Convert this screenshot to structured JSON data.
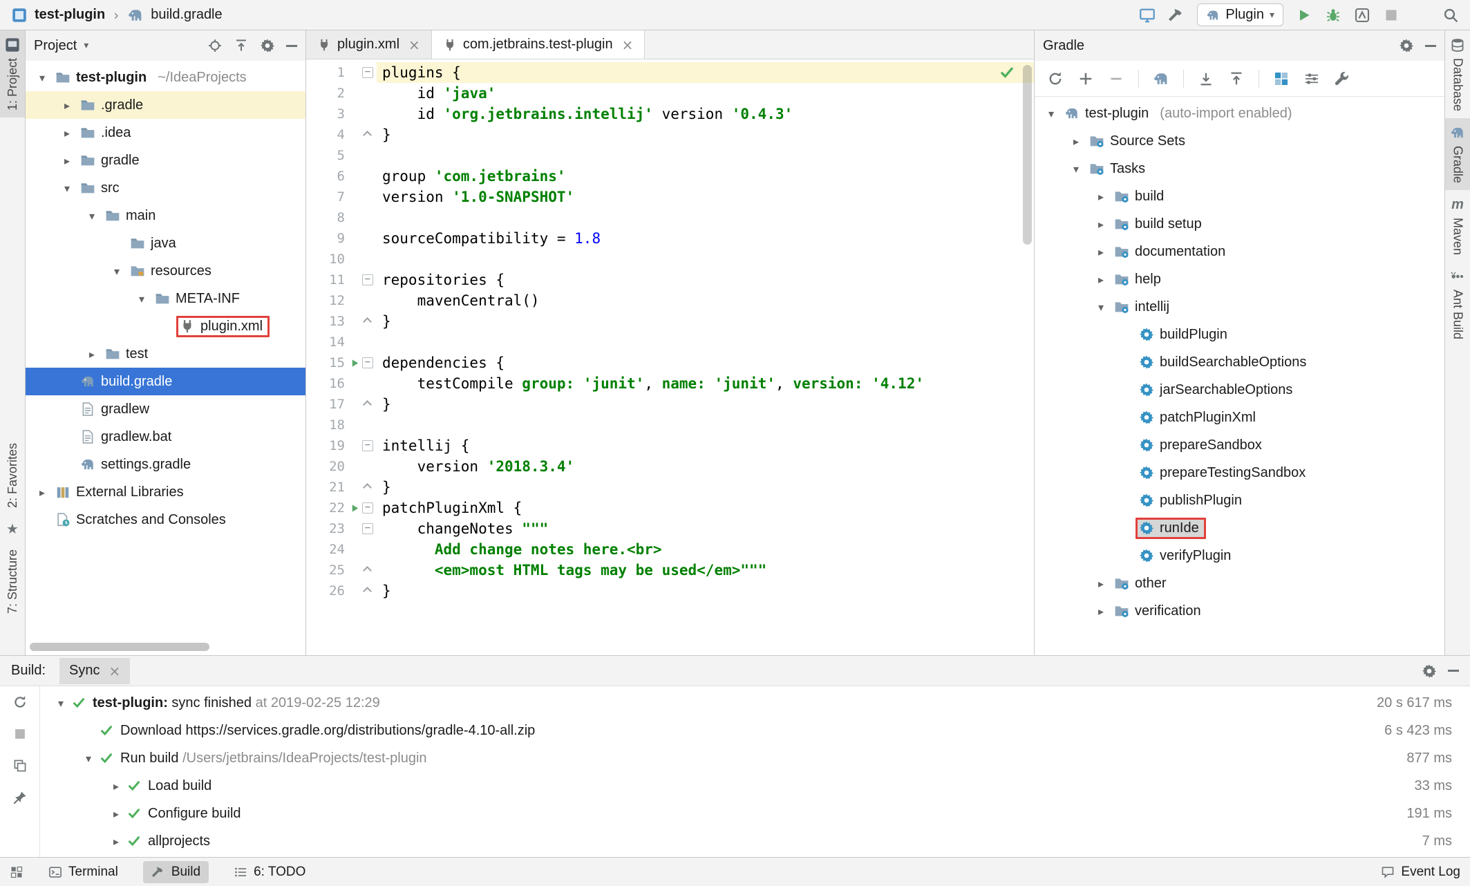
{
  "toolbar": {
    "project_name": "test-plugin",
    "separator": "›",
    "file_name": "build.gradle",
    "run_config": "Plugin"
  },
  "project_panel": {
    "title": "Project",
    "items": [
      {
        "label": "test-plugin",
        "hint": "~/IdeaProjects",
        "depth": 0,
        "arrow": "down",
        "icon": "folder",
        "bold": true
      },
      {
        "label": ".gradle",
        "depth": 1,
        "arrow": "right",
        "icon": "folder",
        "hl": true
      },
      {
        "label": ".idea",
        "depth": 1,
        "arrow": "right",
        "icon": "folder"
      },
      {
        "label": "gradle",
        "depth": 1,
        "arrow": "right",
        "icon": "folder"
      },
      {
        "label": "src",
        "depth": 1,
        "arrow": "down",
        "icon": "folder"
      },
      {
        "label": "main",
        "depth": 2,
        "arrow": "down",
        "icon": "folder"
      },
      {
        "label": "java",
        "depth": 3,
        "arrow": "none",
        "icon": "folder"
      },
      {
        "label": "resources",
        "depth": 3,
        "arrow": "down",
        "icon": "folder-res"
      },
      {
        "label": "META-INF",
        "depth": 4,
        "arrow": "down",
        "icon": "folder"
      },
      {
        "label": "plugin.xml",
        "depth": 5,
        "arrow": "none",
        "icon": "plug",
        "boxed": true
      },
      {
        "label": "test",
        "depth": 2,
        "arrow": "right",
        "icon": "folder"
      },
      {
        "label": "build.gradle",
        "depth": 1,
        "arrow": "none",
        "icon": "gradle",
        "selected": true
      },
      {
        "label": "gradlew",
        "depth": 1,
        "arrow": "none",
        "icon": "text-file"
      },
      {
        "label": "gradlew.bat",
        "depth": 1,
        "arrow": "none",
        "icon": "text-file"
      },
      {
        "label": "settings.gradle",
        "depth": 1,
        "arrow": "none",
        "icon": "gradle"
      },
      {
        "label": "External Libraries",
        "depth": 0,
        "arrow": "right",
        "icon": "libraries"
      },
      {
        "label": "Scratches and Consoles",
        "depth": 0,
        "arrow": "none",
        "icon": "scratches"
      }
    ]
  },
  "editor": {
    "tabs": [
      {
        "label": "plugin.xml",
        "active": false
      },
      {
        "label": "com.jetbrains.test-plugin",
        "active": true
      }
    ],
    "lines": [
      {
        "n": 1,
        "hl": true,
        "fold": "open",
        "seg": [
          [
            "plugins {",
            "d"
          ]
        ]
      },
      {
        "n": 2,
        "seg": [
          [
            "    id ",
            "d"
          ],
          [
            "'java'",
            "s"
          ]
        ]
      },
      {
        "n": 3,
        "seg": [
          [
            "    id ",
            "d"
          ],
          [
            "'org.jetbrains.intellij'",
            "s"
          ],
          [
            " version ",
            "d"
          ],
          [
            "'0.4.3'",
            "s"
          ]
        ]
      },
      {
        "n": 4,
        "fold": "close",
        "seg": [
          [
            "}",
            "d"
          ]
        ]
      },
      {
        "n": 5,
        "seg": []
      },
      {
        "n": 6,
        "seg": [
          [
            "group ",
            "d"
          ],
          [
            "'com.jetbrains'",
            "s"
          ]
        ]
      },
      {
        "n": 7,
        "seg": [
          [
            "version ",
            "d"
          ],
          [
            "'1.0-SNAPSHOT'",
            "s"
          ]
        ]
      },
      {
        "n": 8,
        "seg": []
      },
      {
        "n": 9,
        "seg": [
          [
            "sourceCompatibility = ",
            "d"
          ],
          [
            "1.8",
            "num"
          ]
        ]
      },
      {
        "n": 10,
        "seg": []
      },
      {
        "n": 11,
        "fold": "open",
        "seg": [
          [
            "repositories {",
            "d"
          ]
        ]
      },
      {
        "n": 12,
        "seg": [
          [
            "    mavenCentral()",
            "d"
          ]
        ]
      },
      {
        "n": 13,
        "fold": "close",
        "seg": [
          [
            "}",
            "d"
          ]
        ]
      },
      {
        "n": 14,
        "seg": []
      },
      {
        "n": 15,
        "fold": "open",
        "run": true,
        "seg": [
          [
            "dependencies {",
            "d"
          ]
        ]
      },
      {
        "n": 16,
        "seg": [
          [
            "    testCompile ",
            "d"
          ],
          [
            "group:",
            "a"
          ],
          [
            " ",
            "d"
          ],
          [
            "'junit'",
            "s"
          ],
          [
            ", ",
            "d"
          ],
          [
            "name:",
            "a"
          ],
          [
            " ",
            "d"
          ],
          [
            "'junit'",
            "s"
          ],
          [
            ", ",
            "d"
          ],
          [
            "version:",
            "a"
          ],
          [
            " ",
            "d"
          ],
          [
            "'4.12'",
            "s"
          ]
        ]
      },
      {
        "n": 17,
        "fold": "close",
        "seg": [
          [
            "}",
            "d"
          ]
        ]
      },
      {
        "n": 18,
        "seg": []
      },
      {
        "n": 19,
        "fold": "open",
        "seg": [
          [
            "intellij {",
            "d"
          ]
        ]
      },
      {
        "n": 20,
        "seg": [
          [
            "    version ",
            "d"
          ],
          [
            "'2018.3.4'",
            "s"
          ]
        ]
      },
      {
        "n": 21,
        "fold": "close",
        "seg": [
          [
            "}",
            "d"
          ]
        ]
      },
      {
        "n": 22,
        "fold": "open",
        "run": true,
        "seg": [
          [
            "patchPluginXml {",
            "d"
          ]
        ]
      },
      {
        "n": 23,
        "fold": "open",
        "seg": [
          [
            "    changeNotes ",
            "d"
          ],
          [
            "\"\"\"",
            "s"
          ]
        ]
      },
      {
        "n": 24,
        "seg": [
          [
            "      ",
            "d"
          ],
          [
            "Add change notes here.<br>",
            "s"
          ]
        ]
      },
      {
        "n": 25,
        "fold": "close",
        "seg": [
          [
            "      ",
            "d"
          ],
          [
            "<em>most HTML tags may be used</em>\"\"\"",
            "s"
          ]
        ]
      },
      {
        "n": 26,
        "fold": "close",
        "seg": [
          [
            "}",
            "d"
          ]
        ]
      }
    ]
  },
  "gradle_panel": {
    "title": "Gradle",
    "items": [
      {
        "label": "test-plugin",
        "hint": "(auto-import enabled)",
        "depth": 0,
        "arrow": "down",
        "icon": "gradle"
      },
      {
        "label": "Source Sets",
        "depth": 1,
        "arrow": "right",
        "icon": "tasks-folder"
      },
      {
        "label": "Tasks",
        "depth": 1,
        "arrow": "down",
        "icon": "tasks-folder"
      },
      {
        "label": "build",
        "depth": 2,
        "arrow": "right",
        "icon": "tasks-folder"
      },
      {
        "label": "build setup",
        "depth": 2,
        "arrow": "right",
        "icon": "tasks-folder"
      },
      {
        "label": "documentation",
        "depth": 2,
        "arrow": "right",
        "icon": "tasks-folder"
      },
      {
        "label": "help",
        "depth": 2,
        "arrow": "right",
        "icon": "tasks-folder"
      },
      {
        "label": "intellij",
        "depth": 2,
        "arrow": "down",
        "icon": "tasks-folder"
      },
      {
        "label": "buildPlugin",
        "depth": 3,
        "arrow": "none",
        "icon": "task"
      },
      {
        "label": "buildSearchableOptions",
        "depth": 3,
        "arrow": "none",
        "icon": "task"
      },
      {
        "label": "jarSearchableOptions",
        "depth": 3,
        "arrow": "none",
        "icon": "task"
      },
      {
        "label": "patchPluginXml",
        "depth": 3,
        "arrow": "none",
        "icon": "task"
      },
      {
        "label": "prepareSandbox",
        "depth": 3,
        "arrow": "none",
        "icon": "task"
      },
      {
        "label": "prepareTestingSandbox",
        "depth": 3,
        "arrow": "none",
        "icon": "task"
      },
      {
        "label": "publishPlugin",
        "depth": 3,
        "arrow": "none",
        "icon": "task"
      },
      {
        "label": "runIde",
        "depth": 3,
        "arrow": "none",
        "icon": "task",
        "gray": true,
        "boxed": true
      },
      {
        "label": "verifyPlugin",
        "depth": 3,
        "arrow": "none",
        "icon": "task"
      },
      {
        "label": "other",
        "depth": 2,
        "arrow": "right",
        "icon": "tasks-folder"
      },
      {
        "label": "verification",
        "depth": 2,
        "arrow": "right",
        "icon": "tasks-folder"
      }
    ]
  },
  "build_panel": {
    "label": "Build:",
    "tab": "Sync",
    "rows": [
      {
        "depth": 0,
        "arrow": "down",
        "parts": [
          {
            "t": "test-plugin:",
            "b": true
          },
          {
            "t": " sync finished"
          },
          {
            "t": " at 2019-02-25 12:29",
            "g": true
          }
        ],
        "time": "20 s 617 ms"
      },
      {
        "depth": 1,
        "arrow": "none",
        "parts": [
          {
            "t": "Download https://services.gradle.org/distributions/gradle-4.10-all.zip"
          }
        ],
        "time": "6 s 423 ms"
      },
      {
        "depth": 1,
        "arrow": "down",
        "parts": [
          {
            "t": "Run build "
          },
          {
            "t": "/Users/jetbrains/IdeaProjects/test-plugin",
            "g": true
          }
        ],
        "time": "877 ms"
      },
      {
        "depth": 2,
        "arrow": "right",
        "parts": [
          {
            "t": "Load build"
          }
        ],
        "time": "33 ms"
      },
      {
        "depth": 2,
        "arrow": "right",
        "parts": [
          {
            "t": "Configure build"
          }
        ],
        "time": "191 ms"
      },
      {
        "depth": 2,
        "arrow": "right",
        "parts": [
          {
            "t": "allprojects"
          }
        ],
        "time": "7 ms"
      }
    ]
  },
  "status_bar": {
    "items": [
      {
        "label": "Terminal",
        "icon": "terminal"
      },
      {
        "label": "Build",
        "icon": "hammer",
        "active": true
      },
      {
        "label": "6: TODO",
        "icon": "todo"
      }
    ],
    "event_log": "Event Log"
  },
  "stripes": {
    "left": [
      {
        "label": "1: Project",
        "icon": "project-tool",
        "active": true
      },
      {
        "label": "2: Favorites"
      },
      {
        "label": "7: Structure"
      }
    ],
    "right": [
      {
        "label": "Database",
        "icon": "db"
      },
      {
        "label": "Gradle",
        "icon": "gradle",
        "active": true
      },
      {
        "label": "Maven",
        "icon": "maven"
      },
      {
        "label": "Ant Build",
        "icon": "ant"
      }
    ]
  },
  "colors": {
    "selection_blue": "#3875d6",
    "string_green": "#008000",
    "number_blue": "#0000ff",
    "run_green": "#59a869",
    "annotation_red": "#e2403c"
  }
}
